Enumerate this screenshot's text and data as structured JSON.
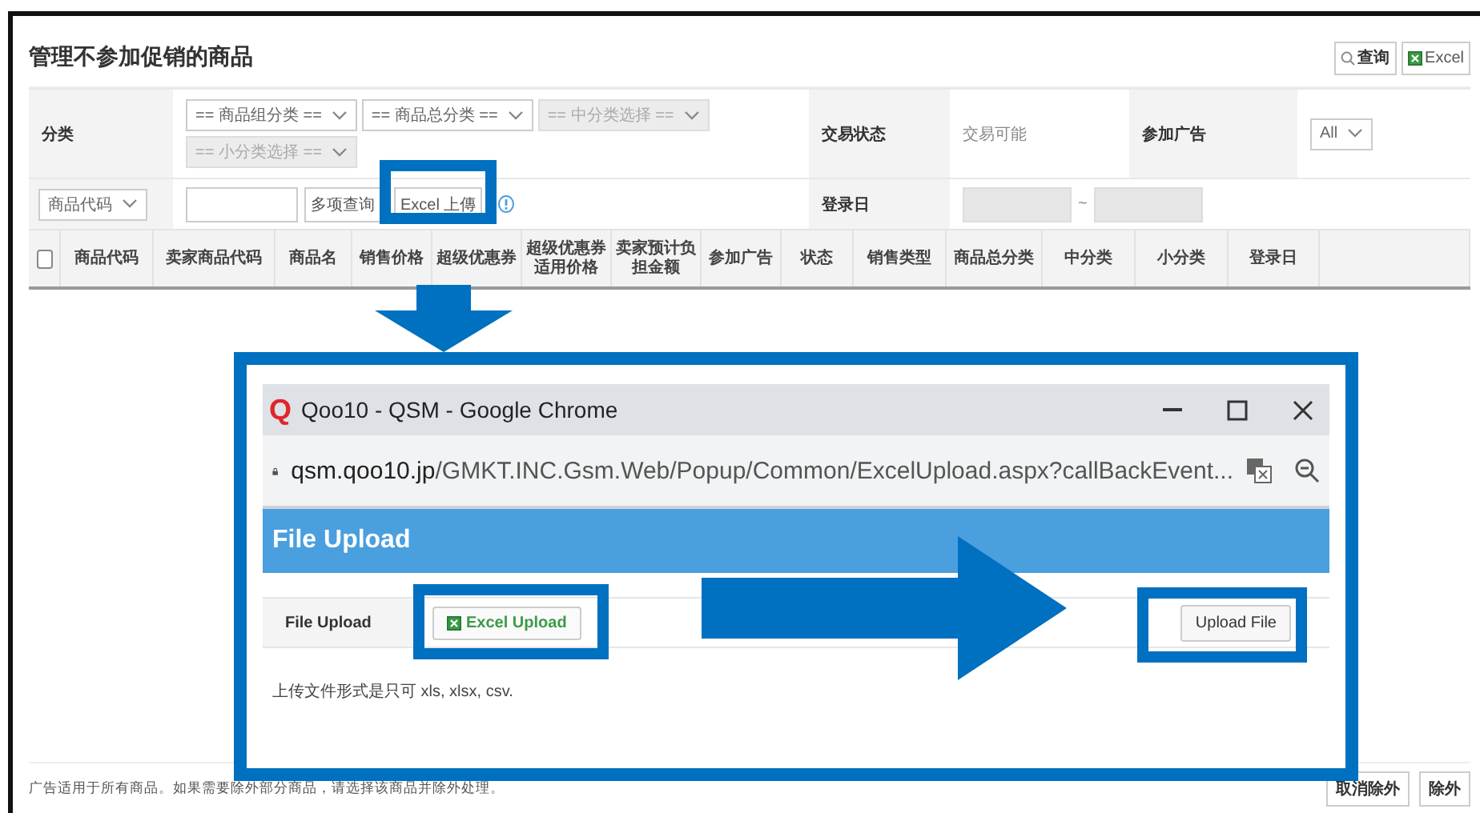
{
  "page": {
    "title": "管理不参加促销的商品",
    "toolbar": [
      {
        "kind": "search",
        "label": "查询"
      },
      {
        "kind": "excel",
        "label": "Excel"
      }
    ]
  },
  "filters": {
    "category": {
      "label": "分类",
      "selects": [
        {
          "text": "== 商品组分类 ==",
          "disabled": false
        },
        {
          "text": "== 商品总分类 ==",
          "disabled": false
        },
        {
          "text": "== 中分类选择 ==",
          "disabled": true
        },
        {
          "text": "== 小分类选择 ==",
          "disabled": true
        }
      ]
    },
    "trade_status": {
      "label": "交易状态",
      "value": "交易可能"
    },
    "ad": {
      "label": "参加广告",
      "select": "All"
    },
    "search_type": "商品代码",
    "search_buttons": [
      "多项查询",
      "Excel 上傳"
    ],
    "date": {
      "label": "登录日",
      "separator": "~"
    }
  },
  "table": {
    "select_all": {
      "checked": false
    },
    "columns": [
      "商品代码",
      "卖家商品代码",
      "商品名",
      "销售价格",
      "超级优惠券",
      "超级优惠券适用价格",
      "卖家预计负担金额",
      "参加广告",
      "状态",
      "销售类型",
      "商品总分类",
      "中分类",
      "小分类",
      "登录日"
    ]
  },
  "footer": {
    "note": "广告适用于所有商品。如果需要除外部分商品，请选择该商品并除外处理。",
    "buttons": [
      "取消除外",
      "除外"
    ]
  },
  "popup": {
    "logo": "Q",
    "window_title": "Qoo10 - QSM - Google Chrome",
    "url_host": "qsm.qoo10.jp",
    "url_path": "/GMKT.INC.Gsm.Web/Popup/Common/ExcelUpload.aspx?callBackEvent...",
    "header": "File Upload",
    "row_label": "File Upload",
    "excel_button": "Excel Upload",
    "upload_button": "Upload File",
    "note": "上传文件形式是只可 xls, xlsx, csv."
  }
}
